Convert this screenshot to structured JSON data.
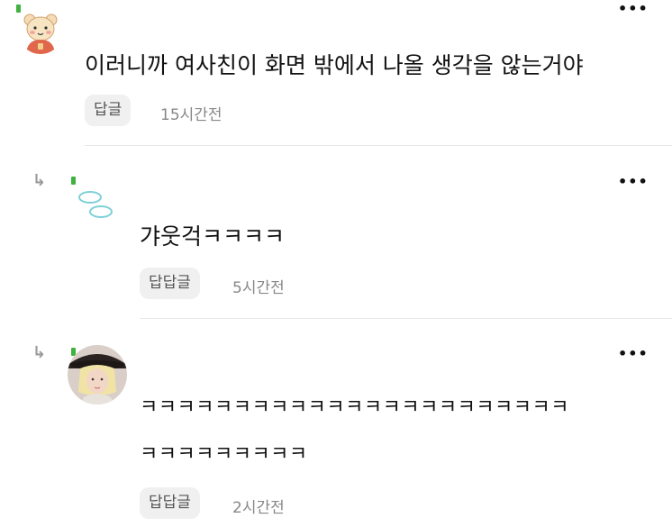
{
  "comments": [
    {
      "text": "이러니까 여사친이 화면 밖에서 나올 생각을 않는거야",
      "reply_label": "답글",
      "time": "15시간전",
      "avatar_icon": "cartoon-bear-avatar",
      "more_icon": "•••"
    },
    {
      "is_reply": true,
      "reply_arrow": "↳",
      "text": "갸웃걱ㅋㅋㅋㅋ",
      "reply_label": "답답글",
      "time": "5시간전",
      "avatar_icon": "blue-circles-avatar",
      "more_icon": "•••"
    },
    {
      "is_reply": true,
      "reply_arrow": "↳",
      "text_line1": "ㅋㅋㅋㅋㅋㅋㅋㅋㅋㅋㅋㅋㅋㅋㅋㅋㅋㅋㅋㅋㅋㅋㅋ",
      "text_line2": "ㅋㅋㅋㅋㅋㅋㅋㅋㅋ",
      "reply_label": "답답글",
      "time": "2시간전",
      "avatar_icon": "blonde-person-photo-avatar",
      "more_icon": "•••"
    }
  ],
  "colors": {
    "level_badge": "#3fb23f",
    "divider": "#e8e8e8",
    "button_bg": "#f0f0f0"
  }
}
